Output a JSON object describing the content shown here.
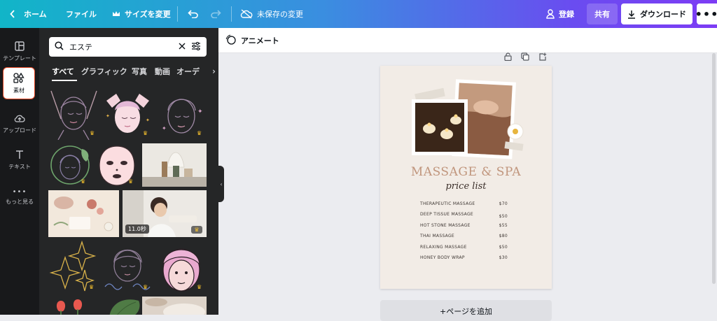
{
  "topbar": {
    "home": "ホーム",
    "file": "ファイル",
    "resize": "サイズを変更",
    "save_status": "未保存の変更",
    "login": "登録",
    "share": "共有",
    "download": "ダウンロード",
    "more": "•••"
  },
  "rail": {
    "items": [
      {
        "label": "テンプレート",
        "icon": "template-icon"
      },
      {
        "label": "素材",
        "icon": "elements-icon"
      },
      {
        "label": "アップロード",
        "icon": "upload-icon"
      },
      {
        "label": "テキスト",
        "icon": "text-icon"
      },
      {
        "label": "もっと見る",
        "icon": "more-icon"
      }
    ]
  },
  "panel": {
    "search_value": "エステ",
    "tabs": [
      "すべて",
      "グラフィック",
      "写真",
      "動画",
      "オーデ"
    ],
    "video_duration": "11.0秒"
  },
  "subbar": {
    "animate": "アニメート"
  },
  "poster": {
    "title": "MASSAGE & SPA",
    "subtitle": "price list",
    "items": [
      {
        "name": "THERAPEUTIC MASSAGE",
        "price": "$70"
      },
      {
        "name": "DEEP TISSUE MASSAGE",
        "price": "$50"
      },
      {
        "name": "HOT STONE MASSAGE",
        "price": "$55"
      },
      {
        "name": "THAI MASSAGE",
        "price": "$80"
      },
      {
        "name": "RELAXING MASSAGE",
        "price": "$50"
      },
      {
        "name": "HONEY BODY WRAP",
        "price": "$30"
      }
    ]
  },
  "add_page": "+ページを追加",
  "colors": {
    "brand_gradient_start": "#11b5c8",
    "brand_gradient_end": "#7d3cf5",
    "poster_title": "#c0957c",
    "active_outline": "#e0421f"
  }
}
